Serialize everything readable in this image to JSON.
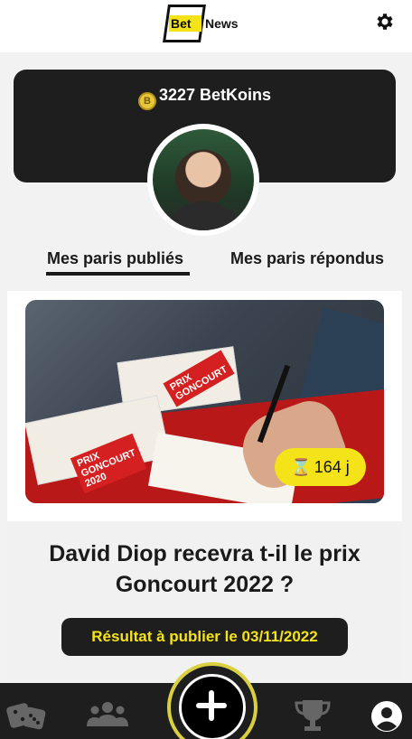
{
  "header": {
    "logo_bet": "Bet",
    "logo_news": "News",
    "settings_icon": "gear-icon"
  },
  "profile": {
    "coins_value": "3227 BetKoins",
    "coin_icon": "coin-icon",
    "avatar": "profile-photo"
  },
  "tabs": {
    "published": "Mes paris publiés",
    "answered": "Mes paris répondus",
    "active": "published"
  },
  "bet": {
    "image": "books-prix-goncourt-photo",
    "timer": "164 j",
    "timer_icon": "hourglass-icon",
    "question": "David Diop recevra t-il le prix Goncourt 2022 ?",
    "result_label": "Résultat à publier le 03/11/2022"
  },
  "bottom_nav": {
    "items": [
      "dice-icon",
      "users-icon",
      "plus-icon",
      "trophy-icon",
      "account-icon"
    ]
  },
  "colors": {
    "accent_yellow": "#f5e31a",
    "dark": "#1e1e1e",
    "background": "#f2f2f2"
  }
}
